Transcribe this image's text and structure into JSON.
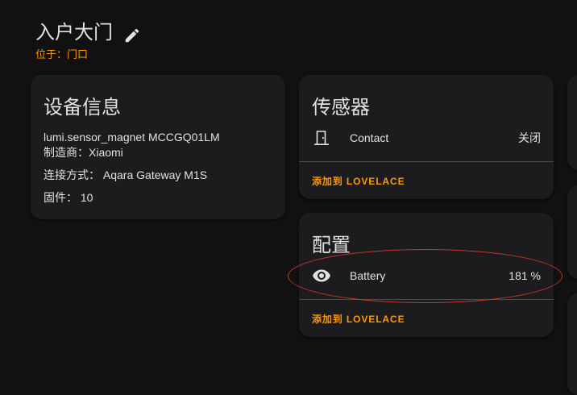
{
  "header": {
    "device_name": "入户大门",
    "area_label": "位于：",
    "area_name": "门口"
  },
  "device_info": {
    "title": "设备信息",
    "model": "lumi.sensor_magnet MCCGQ01LM",
    "manufacturer_label": "制造商：",
    "manufacturer": "Xiaomi",
    "connection_label": "连接方式：",
    "connection": "Aqara Gateway M1S",
    "firmware_label": "固件：",
    "firmware": "10"
  },
  "sensors": {
    "title": "传感器",
    "entities": [
      {
        "name": "Contact",
        "state": "关闭",
        "icon": "door-icon"
      }
    ],
    "add_label": "添加到 LOVELACE"
  },
  "config": {
    "title": "配置",
    "entities": [
      {
        "name": "Battery",
        "state": "181 %",
        "icon": "eye-icon"
      }
    ],
    "add_label": "添加到 LOVELACE"
  },
  "colors": {
    "accent": "#ff9800",
    "background": "#111111",
    "card": "#1c1c1e",
    "annotation": "#c0392b"
  }
}
